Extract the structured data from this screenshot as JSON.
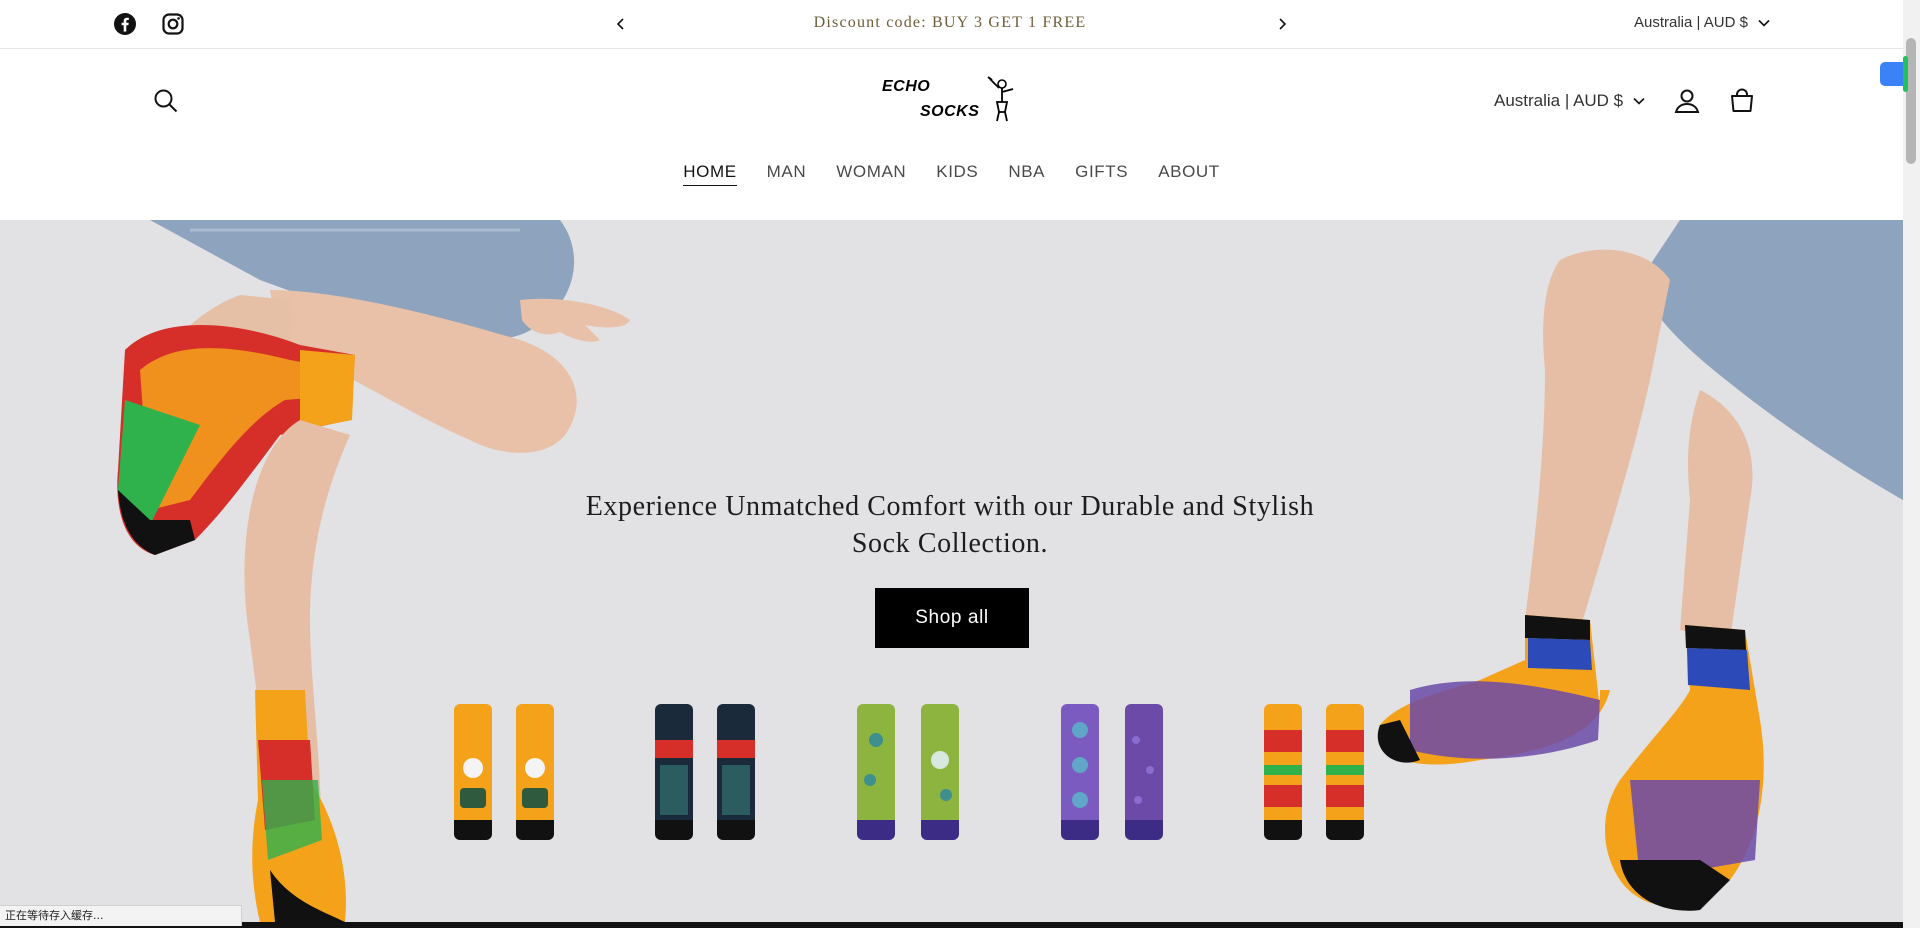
{
  "announcement": {
    "text": "Discount code:  BUY 3 GET 1 FREE",
    "social": [
      "facebook-icon",
      "instagram-icon"
    ]
  },
  "locale": {
    "top_label": "Australia | AUD $",
    "header_label": "Australia | AUD $"
  },
  "brand": {
    "line1": "ECHO",
    "line2": "SOCKS"
  },
  "nav": {
    "items": [
      {
        "label": "HOME",
        "active": true
      },
      {
        "label": "MAN"
      },
      {
        "label": "WOMAN"
      },
      {
        "label": "KIDS"
      },
      {
        "label": "NBA"
      },
      {
        "label": "GIFTS"
      },
      {
        "label": "ABOUT"
      }
    ]
  },
  "hero": {
    "title": "Experience Unmatched Comfort with our Durable and Stylish Sock Collection.",
    "button": "Shop all"
  },
  "status_bar": {
    "text": "正在等待存入缓存..."
  },
  "colors": {
    "hero_background": "#e2e1e4",
    "button": "#000000",
    "sock_orange": "#f5a21b",
    "sock_purple": "#6b4aa8",
    "sock_green": "#8db43f"
  }
}
